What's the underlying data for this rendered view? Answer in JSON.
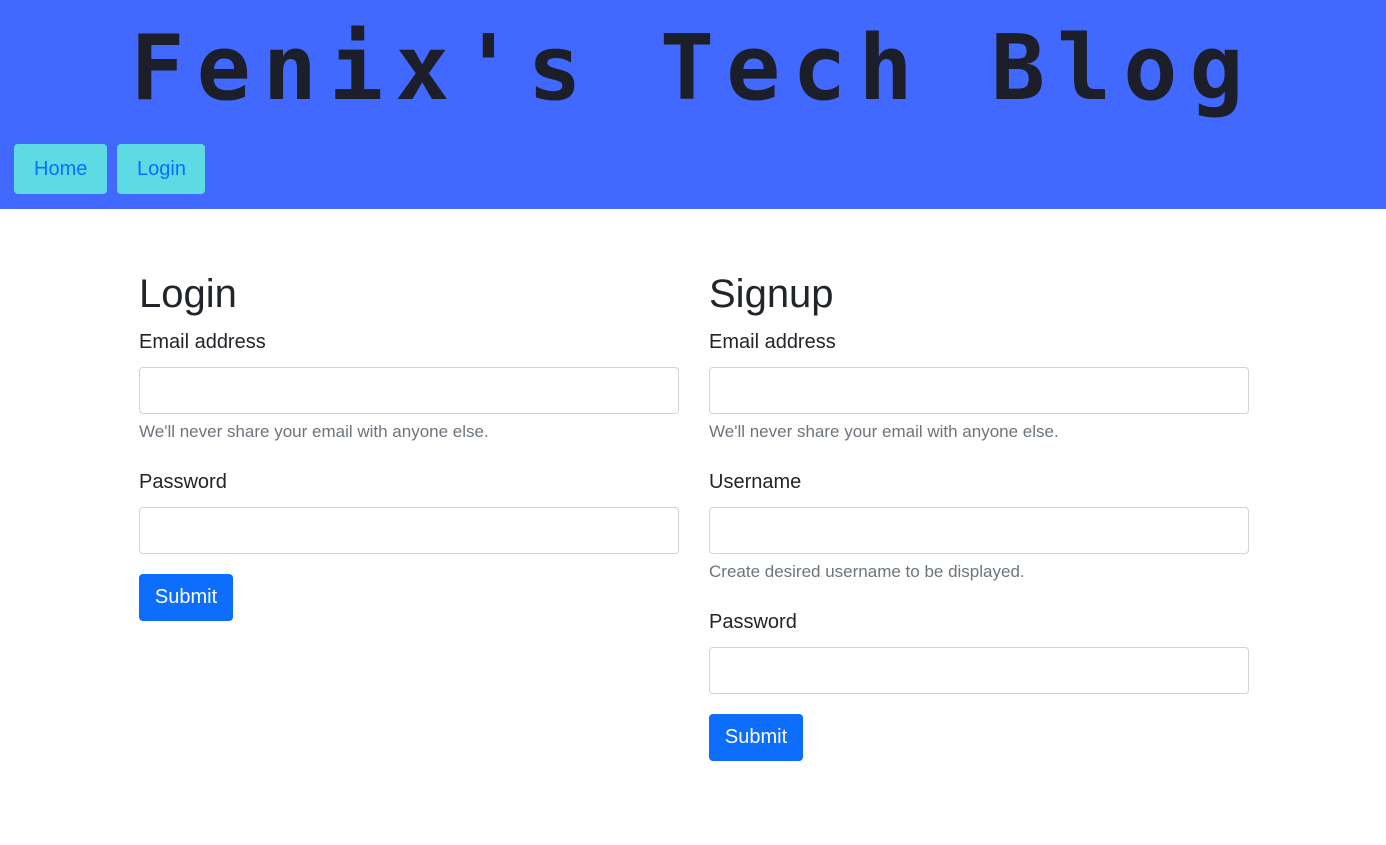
{
  "header": {
    "title": "Fenix's Tech Blog",
    "nav": [
      {
        "label": "Home"
      },
      {
        "label": "Login"
      }
    ]
  },
  "login_form": {
    "heading": "Login",
    "email_label": "Email address",
    "email_value": "",
    "email_help": "We'll never share your email with anyone else.",
    "password_label": "Password",
    "password_value": "",
    "submit_label": "Submit"
  },
  "signup_form": {
    "heading": "Signup",
    "email_label": "Email address",
    "email_value": "",
    "email_help": "We'll never share your email with anyone else.",
    "username_label": "Username",
    "username_value": "",
    "username_help": "Create desired username to be displayed.",
    "password_label": "Password",
    "password_value": "",
    "submit_label": "Submit"
  },
  "colors": {
    "header_bg": "#4169ff",
    "nav_button_bg": "#5ddbe5",
    "primary": "#0d6efd",
    "muted_text": "#6c757d"
  }
}
